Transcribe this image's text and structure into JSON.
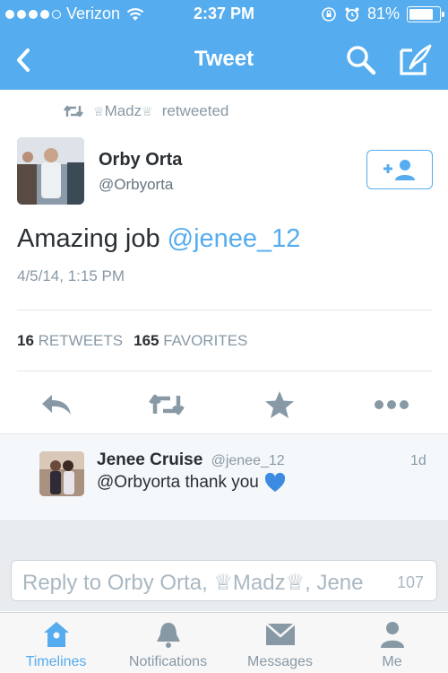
{
  "status_bar": {
    "carrier": "Verizon",
    "time": "2:37 PM",
    "battery_percent": "81%",
    "signal_bars_filled": 4,
    "signal_bars_total": 5
  },
  "nav": {
    "title": "Tweet",
    "back_icon": "chevron-left-icon",
    "search_icon": "search-icon",
    "compose_icon": "compose-icon"
  },
  "retweet_header": {
    "user": "Madz",
    "crown": "♕",
    "text": "retweeted"
  },
  "tweet": {
    "author_name": "Orby Orta",
    "author_handle": "@Orbyorta",
    "text": "Amazing job",
    "mention": "@jenee_12",
    "timestamp": "4/5/14, 1:15 PM",
    "retweets_count": "16",
    "retweets_label": "RETWEETS",
    "favorites_count": "165",
    "favorites_label": "FAVORITES"
  },
  "reply": {
    "name": "Jenee Cruise",
    "handle": "@jenee_12",
    "age": "1d",
    "text": "@Orbyorta thank you",
    "emoji_name": "blue-heart-icon"
  },
  "reply_input": {
    "placeholder": "Reply to Orby Orta, ♕Madz♕, Jene",
    "char_count": "107"
  },
  "tabs": [
    {
      "label": "Timelines",
      "icon": "home-icon",
      "active": true
    },
    {
      "label": "Notifications",
      "icon": "bell-icon",
      "active": false
    },
    {
      "label": "Messages",
      "icon": "envelope-icon",
      "active": false
    },
    {
      "label": "Me",
      "icon": "person-icon",
      "active": false
    }
  ],
  "colors": {
    "brand": "#55acee",
    "text": "#292f33",
    "muted": "#8899a6"
  }
}
